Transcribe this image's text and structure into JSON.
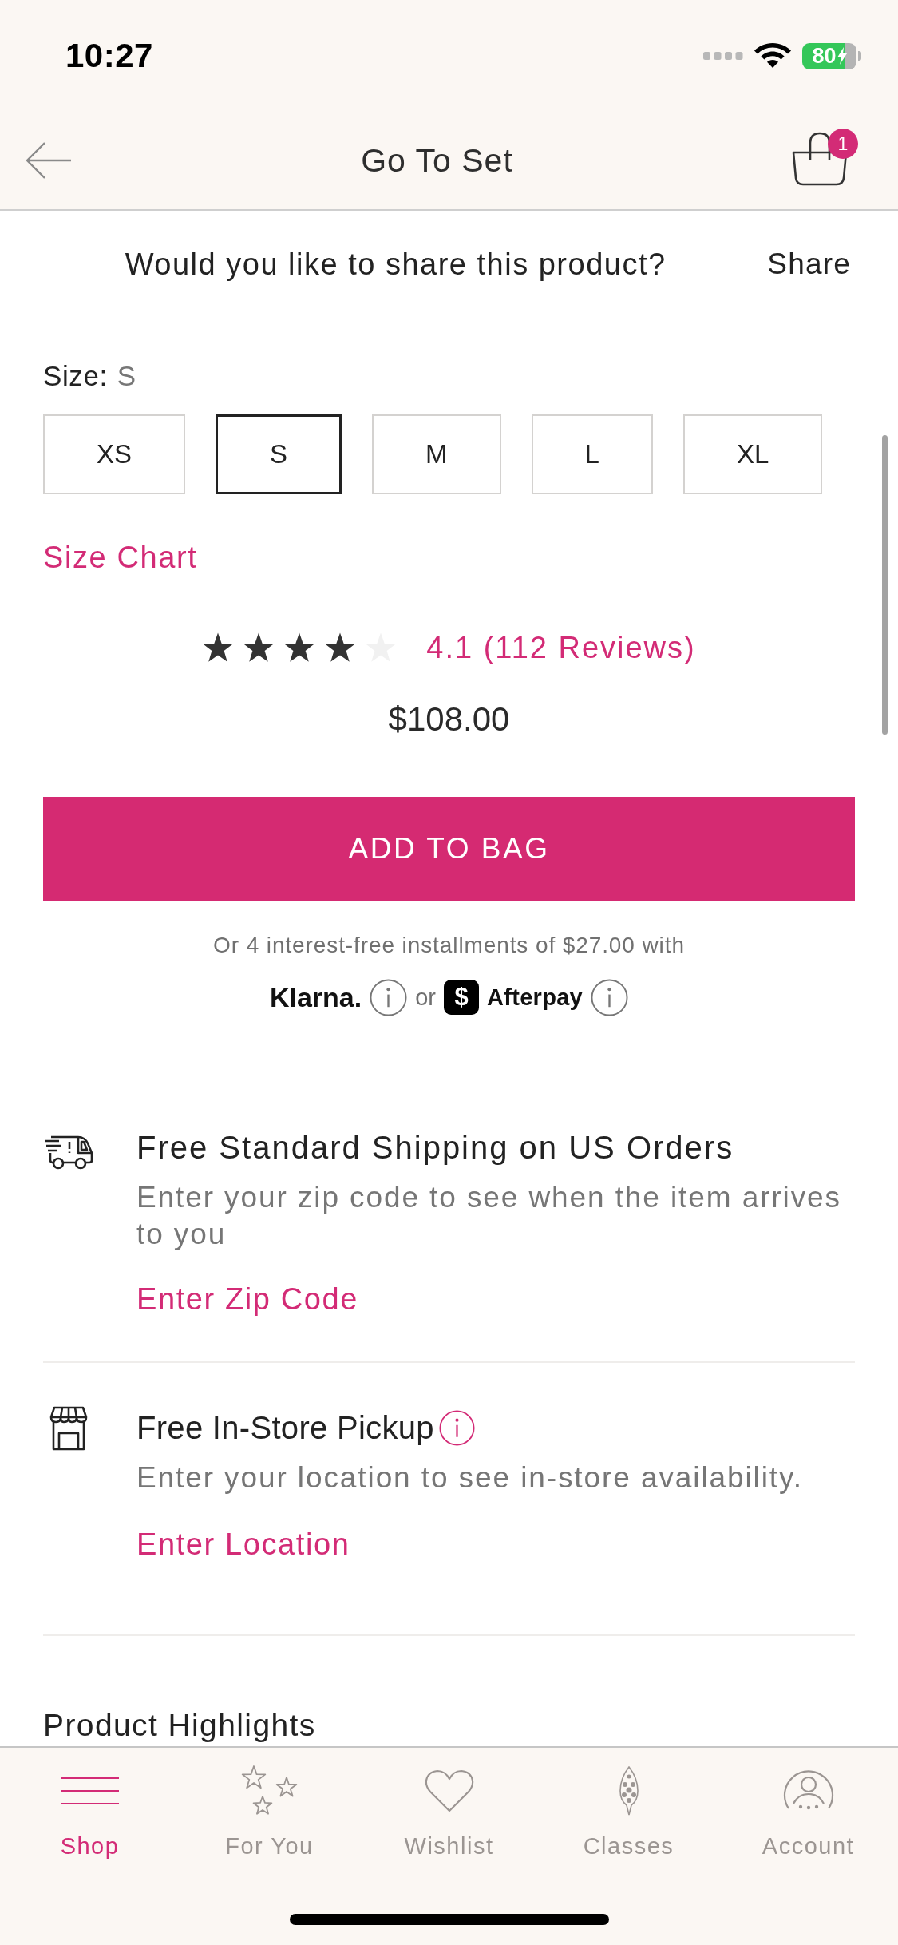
{
  "status_bar": {
    "time": "10:27",
    "battery": "80"
  },
  "header": {
    "title": "Go To Set",
    "bag_count": "1"
  },
  "share": {
    "prompt": "Would you like to share this product?",
    "action": "Share"
  },
  "size": {
    "label": "Size:",
    "value": "S",
    "options": [
      {
        "label": "XS",
        "selected": false
      },
      {
        "label": "S",
        "selected": true
      },
      {
        "label": "M",
        "selected": false
      },
      {
        "label": "L",
        "selected": false
      },
      {
        "label": "XL",
        "selected": false
      }
    ],
    "chart_link": "Size Chart"
  },
  "rating": {
    "stars": 4,
    "summary": "4.1 (112 Reviews)"
  },
  "price": "$108.00",
  "add_to_bag": "ADD TO BAG",
  "installments": {
    "text": "Or 4 interest-free installments of $27.00 with",
    "separator": "or",
    "providers": [
      {
        "kind": "klarna",
        "name": "Klarna."
      },
      {
        "kind": "afterpay",
        "symbol": "$",
        "name": "Afterpay"
      }
    ]
  },
  "fulfillment": [
    {
      "kind": "shipping",
      "title": "Free Standard Shipping on US Orders",
      "info": false,
      "description": "Enter your zip code to see when the item arrives to you",
      "link": "Enter Zip Code"
    },
    {
      "kind": "pickup",
      "title": "Free In-Store Pickup",
      "info": true,
      "description": "Enter your location to see in-store availability.",
      "link": "Enter Location"
    }
  ],
  "section_heading": "Product Highlights",
  "tab_bar": [
    {
      "kind": "shop",
      "label": "Shop",
      "selected": true
    },
    {
      "kind": "for_you",
      "label": "For You",
      "selected": false
    },
    {
      "kind": "wishlist",
      "label": "Wishlist",
      "selected": false
    },
    {
      "kind": "classes",
      "label": "Classes",
      "selected": false
    },
    {
      "kind": "account",
      "label": "Account",
      "selected": false
    }
  ]
}
